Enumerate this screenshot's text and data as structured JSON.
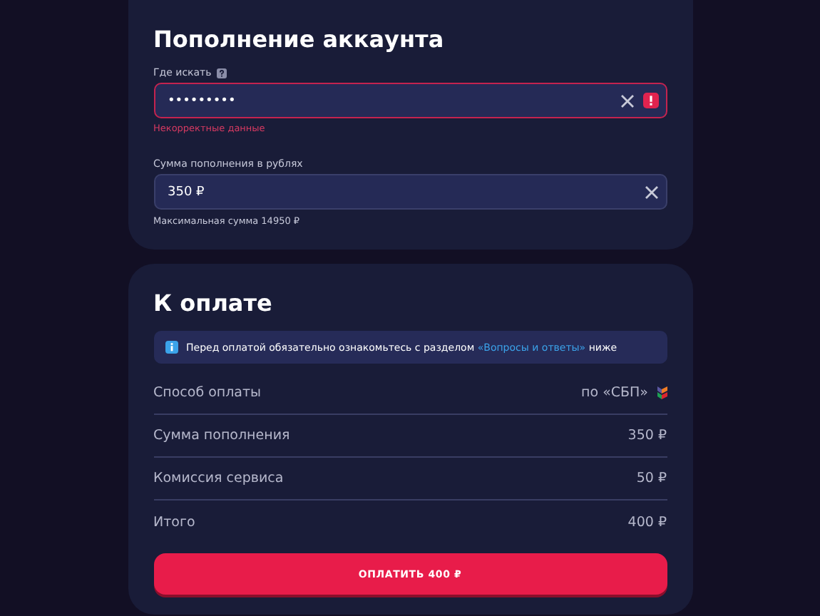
{
  "account": {
    "title": "Пополнение аккаунта",
    "fields": [
      {
        "label": "Где искать",
        "help": true,
        "value": "•••••••••",
        "error": true,
        "error_text": "Некорректные данные"
      },
      {
        "label": "Сумма пополнения в рублях",
        "help": false,
        "value": "350 ₽",
        "error": false,
        "hint": "Максимальная сумма 14950 ₽"
      }
    ]
  },
  "payment": {
    "title": "К оплате",
    "notice": {
      "before": "Перед оплатой обязательно ознакомьтесь с разделом",
      "link": "«Вопросы и ответы»",
      "after": "ниже"
    },
    "rows": [
      {
        "label": "Способ оплаты",
        "value": "по «СБП»",
        "kind": "method"
      },
      {
        "label": "Сумма пополнения",
        "value": "350 ₽",
        "kind": "plain"
      },
      {
        "label": "Комиссия сервиса",
        "value": "50 ₽",
        "kind": "plain"
      },
      {
        "label": "Итого",
        "value": "400 ₽",
        "kind": "plain"
      }
    ],
    "button": "ОПЛАТИТЬ 400 ₽"
  }
}
